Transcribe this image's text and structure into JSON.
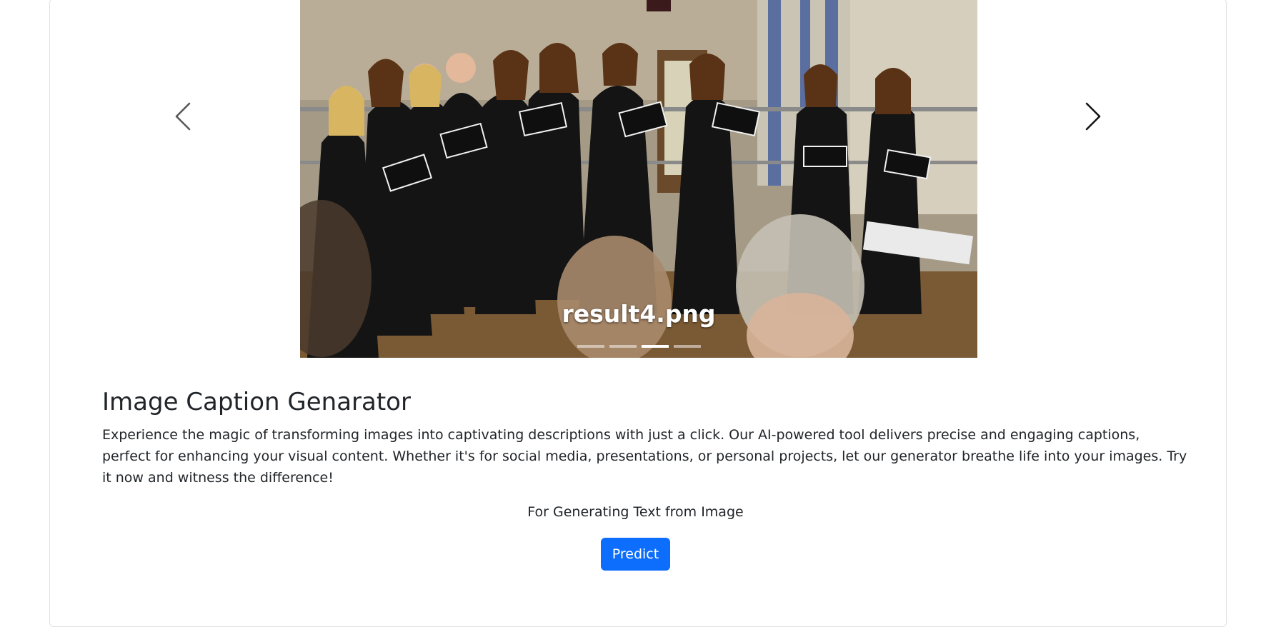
{
  "carousel": {
    "caption": "result4.png",
    "indicators": [
      {
        "label": "Slide 1",
        "active": false
      },
      {
        "label": "Slide 2",
        "active": false
      },
      {
        "label": "Slide 3",
        "active": true
      },
      {
        "label": "Slide 4",
        "active": false
      }
    ],
    "prev_icon": "chevron-left-icon",
    "next_icon": "chevron-right-icon"
  },
  "main": {
    "title": "Image Caption Genarator",
    "description": "Experience the magic of transforming images into captivating descriptions with just a click. Our AI-powered tool delivers precise and engaging captions, perfect for enhancing your visual content. Whether it's for social media, presentations, or personal projects, let our generator breathe life into your images. Try it now and witness the difference!",
    "subtitle": "For Generating Text from Image",
    "predict_label": "Predict"
  },
  "colors": {
    "primary": "#0d6efd",
    "text": "#212529",
    "border": "#dee2e6"
  }
}
